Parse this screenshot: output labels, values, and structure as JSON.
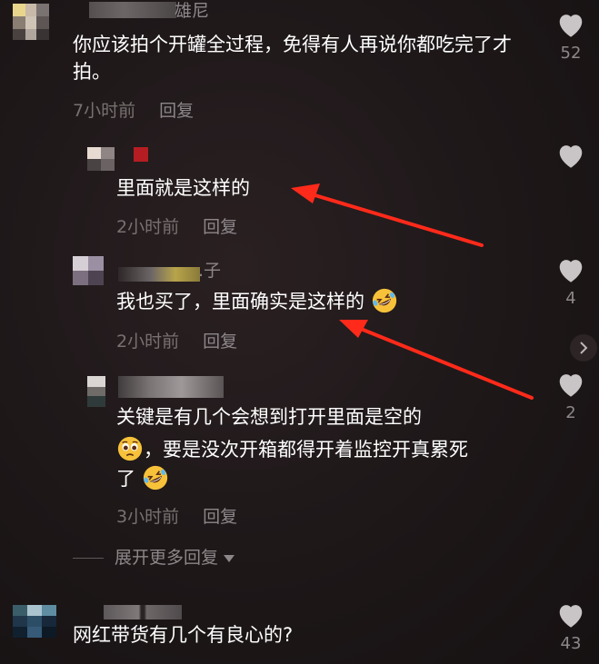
{
  "comments": [
    {
      "name": "雄尼",
      "text": "你应该拍个开罐全过程，免得有人再说你都吃完了才拍。",
      "time": "7小时前",
      "reply": "回复",
      "likes": "52"
    },
    {
      "name": "",
      "text": "网红带货有几个有良心的?",
      "time": "",
      "reply": "",
      "likes": "43"
    }
  ],
  "replies": [
    {
      "name": "",
      "text": "里面就是这样的",
      "time": "2小时前",
      "reply": "回复",
      "likes": ""
    },
    {
      "name": ".子",
      "text": "我也买了，里面确实是这样的",
      "time": "2小时前",
      "reply": "回复",
      "likes": "4"
    },
    {
      "name": "",
      "text_line1": "关键是有几个会想到打开里面是空的",
      "text_line2": "，要是没次开箱都得开着监控开真累死",
      "text_line3": "了",
      "time": "3小时前",
      "reply": "回复",
      "likes": "2"
    }
  ],
  "expand_more": "展开更多回复",
  "icons": {
    "like": "heart-icon",
    "more": "chevron-right-icon",
    "emoji_laugh": "rolling-on-floor-laughing-emoji",
    "emoji_plead": "pleading-face-emoji"
  },
  "colors": {
    "background": "#1b1516",
    "text": "#ffffff",
    "muted": "#8d8789",
    "annotation_arrow": "#ff2a1a"
  }
}
